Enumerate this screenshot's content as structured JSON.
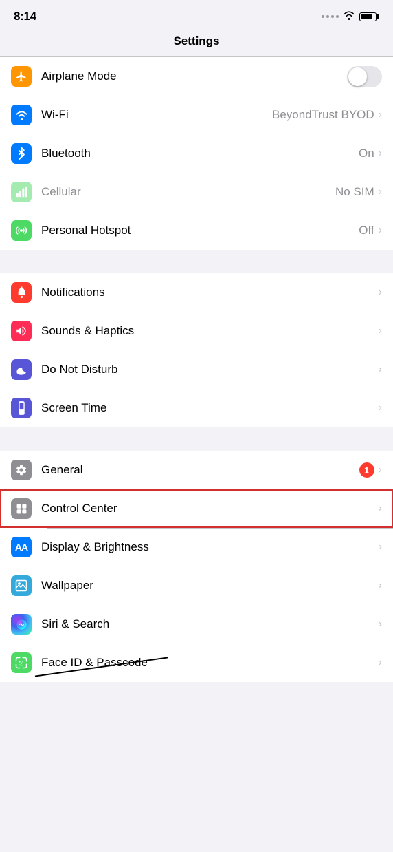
{
  "statusBar": {
    "time": "8:14",
    "signal": "····",
    "battery": "80"
  },
  "pageTitle": "Settings",
  "groups": [
    {
      "id": "connectivity",
      "rows": [
        {
          "id": "airplane-mode",
          "label": "Airplane Mode",
          "iconBg": "#ff9500",
          "iconSymbol": "✈",
          "iconFontSize": "16px",
          "type": "toggle",
          "toggleOn": false,
          "value": "",
          "highlighted": false,
          "disabled": false
        },
        {
          "id": "wifi",
          "label": "Wi-Fi",
          "iconBg": "#007aff",
          "iconSymbol": "wifi",
          "type": "chevron",
          "value": "BeyondTrust BYOD",
          "highlighted": false,
          "disabled": false
        },
        {
          "id": "bluetooth",
          "label": "Bluetooth",
          "iconBg": "#007aff",
          "iconSymbol": "bluetooth",
          "type": "chevron",
          "value": "On",
          "highlighted": false,
          "disabled": false
        },
        {
          "id": "cellular",
          "label": "Cellular",
          "iconBg": "#4cd964",
          "iconSymbol": "cellular",
          "type": "chevron",
          "value": "No SIM",
          "highlighted": false,
          "disabled": true
        },
        {
          "id": "personal-hotspot",
          "label": "Personal Hotspot",
          "iconBg": "#4cd964",
          "iconSymbol": "hotspot",
          "type": "chevron",
          "value": "Off",
          "highlighted": false,
          "disabled": false
        }
      ]
    },
    {
      "id": "notifications",
      "rows": [
        {
          "id": "notifications",
          "label": "Notifications",
          "iconBg": "#ff3b30",
          "iconSymbol": "notif",
          "type": "chevron",
          "value": "",
          "highlighted": false,
          "disabled": false
        },
        {
          "id": "sounds",
          "label": "Sounds & Haptics",
          "iconBg": "#ff2d55",
          "iconSymbol": "sound",
          "type": "chevron",
          "value": "",
          "highlighted": false,
          "disabled": false
        },
        {
          "id": "do-not-disturb",
          "label": "Do Not Disturb",
          "iconBg": "#5856d6",
          "iconSymbol": "moon",
          "type": "chevron",
          "value": "",
          "highlighted": false,
          "disabled": false
        },
        {
          "id": "screen-time",
          "label": "Screen Time",
          "iconBg": "#5856d6",
          "iconSymbol": "hourglass",
          "type": "chevron",
          "value": "",
          "highlighted": false,
          "disabled": false
        }
      ]
    },
    {
      "id": "general",
      "rows": [
        {
          "id": "general",
          "label": "General",
          "iconBg": "#8e8e93",
          "iconSymbol": "gear",
          "type": "badge-chevron",
          "badgeCount": "1",
          "value": "",
          "highlighted": false,
          "disabled": false
        },
        {
          "id": "control-center",
          "label": "Control Center",
          "iconBg": "#8e8e93",
          "iconSymbol": "controls",
          "type": "chevron",
          "value": "",
          "highlighted": true,
          "disabled": false
        },
        {
          "id": "display-brightness",
          "label": "Display & Brightness",
          "iconBg": "#007aff",
          "iconSymbol": "AA",
          "type": "chevron",
          "value": "",
          "highlighted": false,
          "disabled": false
        },
        {
          "id": "wallpaper",
          "label": "Wallpaper",
          "iconBg": "#34aadc",
          "iconSymbol": "wallpaper",
          "type": "chevron",
          "value": "",
          "highlighted": false,
          "disabled": false
        },
        {
          "id": "siri-search",
          "label": "Siri & Search",
          "iconBg": "#000",
          "iconSymbol": "siri",
          "type": "chevron",
          "value": "",
          "highlighted": false,
          "disabled": false
        },
        {
          "id": "face-id",
          "label": "Face ID & Passcode",
          "iconBg": "#4cd964",
          "iconSymbol": "faceid",
          "type": "chevron",
          "value": "",
          "highlighted": false,
          "disabled": false,
          "strikethrough": true
        }
      ]
    }
  ]
}
